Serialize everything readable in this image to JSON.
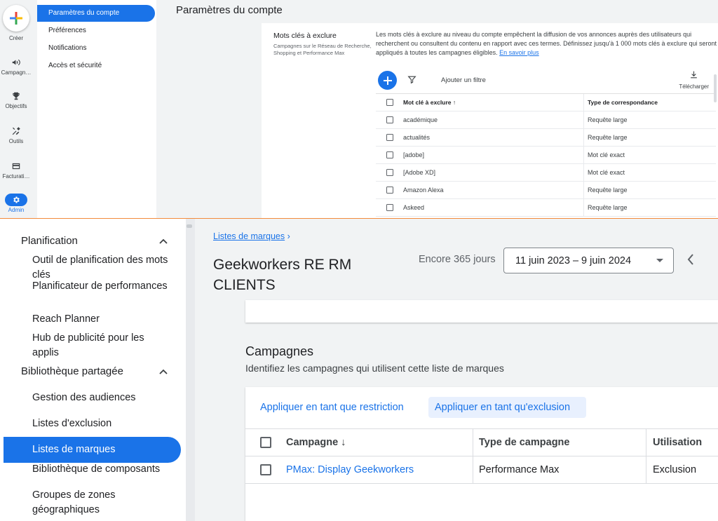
{
  "rail": {
    "create": "Créer",
    "items": [
      {
        "label": "Campagn…",
        "icon": "megaphone-icon"
      },
      {
        "label": "Objectifs",
        "icon": "trophy-icon"
      },
      {
        "label": "Outils",
        "icon": "tools-icon"
      },
      {
        "label": "Facturati…",
        "icon": "credit-card-icon"
      },
      {
        "label": "Admin",
        "icon": "gear-icon"
      }
    ]
  },
  "subnav": {
    "items": [
      "Paramètres du compte",
      "Préférences",
      "Notifications",
      "Accès et sécurité"
    ]
  },
  "account": {
    "title": "Paramètres du compte",
    "kw_title": "Mots clés à exclure",
    "kw_sub": "Campagnes sur le Réseau de Recherche, Shopping et Performance Max",
    "kw_desc": "Les mots clés à exclure au niveau du compte empêchent la diffusion de vos annonces auprès des utilisateurs qui recherchent ou consultent du contenu en rapport avec ces termes. Définissez jusqu'à 1 000 mots clés à exclure qui seront appliqués à toutes les campagnes éligibles.",
    "learn_more": "En savoir plus",
    "add_filter": "Ajouter un filtre",
    "download": "Télécharger",
    "headers": [
      "Mot clé à exclure",
      "Type de correspondance"
    ],
    "sort_glyph": "↑",
    "rows": [
      [
        "académique",
        "Requête large"
      ],
      [
        "actualités",
        "Requête large"
      ],
      [
        "[adobe]",
        "Mot clé exact"
      ],
      [
        "[Adobe XD]",
        "Mot clé exact"
      ],
      [
        "Amazon Alexa",
        "Requête large"
      ],
      [
        "Askeed",
        "Requête large"
      ]
    ]
  },
  "bside": {
    "planification": "Planification",
    "plan_items": [
      "Outil de planification des mots clés",
      "Planificateur de performances",
      "Reach Planner",
      "Hub de publicité pour les applis"
    ],
    "library": "Bibliothèque partagée",
    "lib_items": [
      "Gestion des audiences",
      "Listes d'exclusion",
      "Listes de marques",
      "Bibliothèque de composants",
      "Groupes de zones géographiques"
    ]
  },
  "bmain": {
    "breadcrumb": "Listes de marques",
    "crumb_sep": "›",
    "title": "Geekworkers RE RM CLIENTS",
    "remaining": "Encore 365 jours",
    "date_range": "11 juin 2023 – 9 juin 2024",
    "campaigns_title": "Campagnes",
    "campaigns_sub": "Identifiez les campagnes qui utilisent cette liste de marques",
    "apply_restriction": "Appliquer en tant que restriction",
    "apply_exclusion": "Appliquer en tant qu'exclusion",
    "headers": [
      "Campagne",
      "Type de campagne",
      "Utilisation"
    ],
    "sort_glyph": "↓",
    "rows": [
      {
        "campaign": "PMax: Display Geekworkers",
        "type": "Performance Max",
        "usage": "Exclusion"
      }
    ]
  },
  "colors": {
    "accent": "#1a73e8",
    "divider": "#f28b3c"
  }
}
